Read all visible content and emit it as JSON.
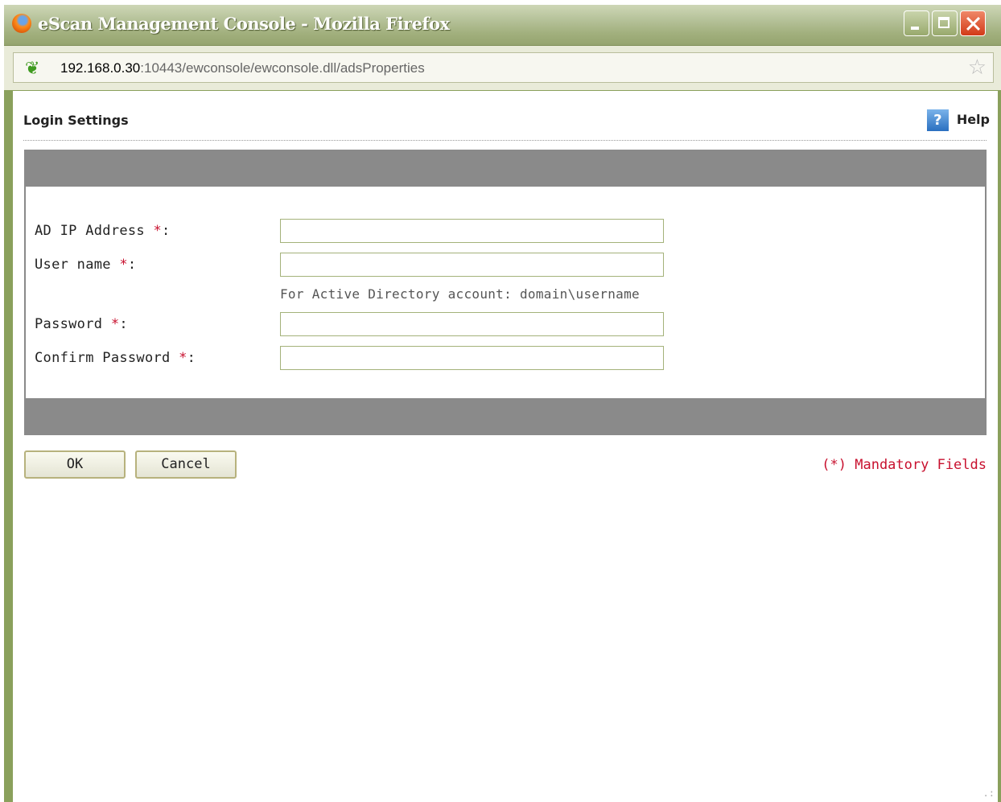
{
  "window": {
    "title": "eScan Management Console - Mozilla Firefox"
  },
  "urlbar": {
    "host": "192.168.0.30",
    "path": ":10443/ewconsole/ewconsole.dll/adsProperties"
  },
  "page": {
    "heading": "Login Settings",
    "help_label": "Help",
    "fields": [
      {
        "label": "AD IP Address",
        "required_mark": "*",
        "suffix": ":",
        "value": ""
      },
      {
        "label": "User name",
        "required_mark": "*",
        "suffix": ":",
        "value": ""
      },
      {
        "label": "Password",
        "required_mark": "*",
        "suffix": ":",
        "value": ""
      },
      {
        "label": "Confirm Password",
        "required_mark": "*",
        "suffix": ":",
        "value": ""
      }
    ],
    "username_hint": "For Active Directory account: domain\\username",
    "ok_label": "OK",
    "cancel_label": "Cancel",
    "mandatory_note": "(*) Mandatory Fields"
  },
  "icons": {
    "app": "firefox-icon",
    "site": "site-identity-icon",
    "bookmark": "star-icon",
    "help": "help-icon"
  }
}
